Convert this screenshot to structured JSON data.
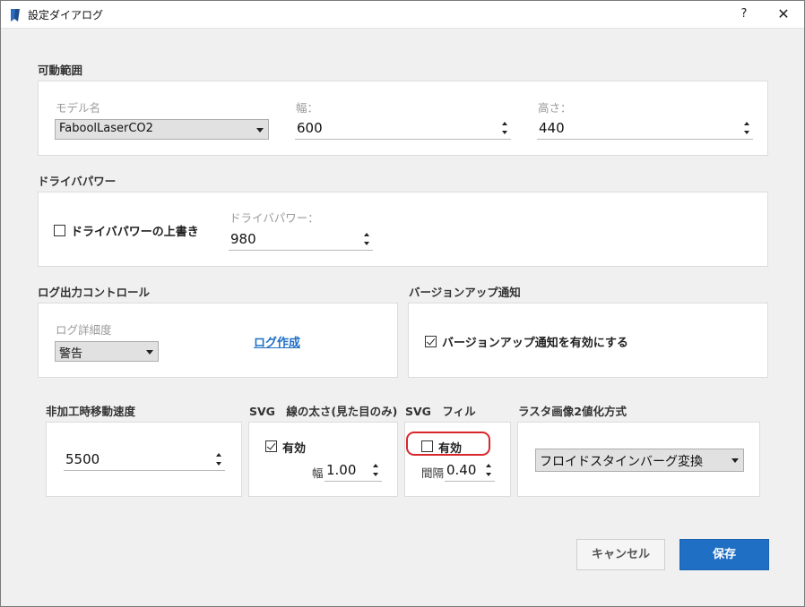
{
  "window": {
    "title": "設定ダイアログ",
    "help": "?",
    "close": "✕"
  },
  "range": {
    "label": "可動範囲",
    "model_label": "モデル名",
    "model_value": "FaboolLaserCO2",
    "width_label": "幅：",
    "width_value": "600",
    "height_label": "高さ：",
    "height_value": "440"
  },
  "driver": {
    "label": "ドライバパワー",
    "override_label": "ドライバパワーの上書き",
    "override_checked": false,
    "power_label": "ドライバパワー：",
    "power_value": "980"
  },
  "log": {
    "label": "ログ出力コントロール",
    "level_label": "ログ詳細度",
    "level_value": "警告",
    "create_link": "ログ作成"
  },
  "version": {
    "label": "バージョンアップ通知",
    "enable_label": "バージョンアップ通知を有効にする",
    "enable_checked": true
  },
  "speed": {
    "label": "非加工時移動速度",
    "value": "5500"
  },
  "svg_line": {
    "label": "SVG　線の太さ(見た目のみ)",
    "enable_label": "有効",
    "enable_checked": true,
    "width_label": "幅",
    "width_value": "1.00"
  },
  "svg_fill": {
    "label": "SVG　フィル",
    "enable_label": "有効",
    "enable_checked": false,
    "interval_label": "間隔",
    "interval_value": "0.40"
  },
  "raster": {
    "label": "ラスタ画像2値化方式",
    "method_value": "フロイドスタインバーグ変換"
  },
  "buttons": {
    "cancel": "キャンセル",
    "save": "保存"
  },
  "colors": {
    "accent": "#1f6fc4",
    "highlight": "#d9262c",
    "link": "#1e6fc5"
  },
  "icons": {
    "app": "app-flag-icon",
    "spin": "spin-arrows-icon",
    "dropdown": "chevron-down-icon"
  }
}
